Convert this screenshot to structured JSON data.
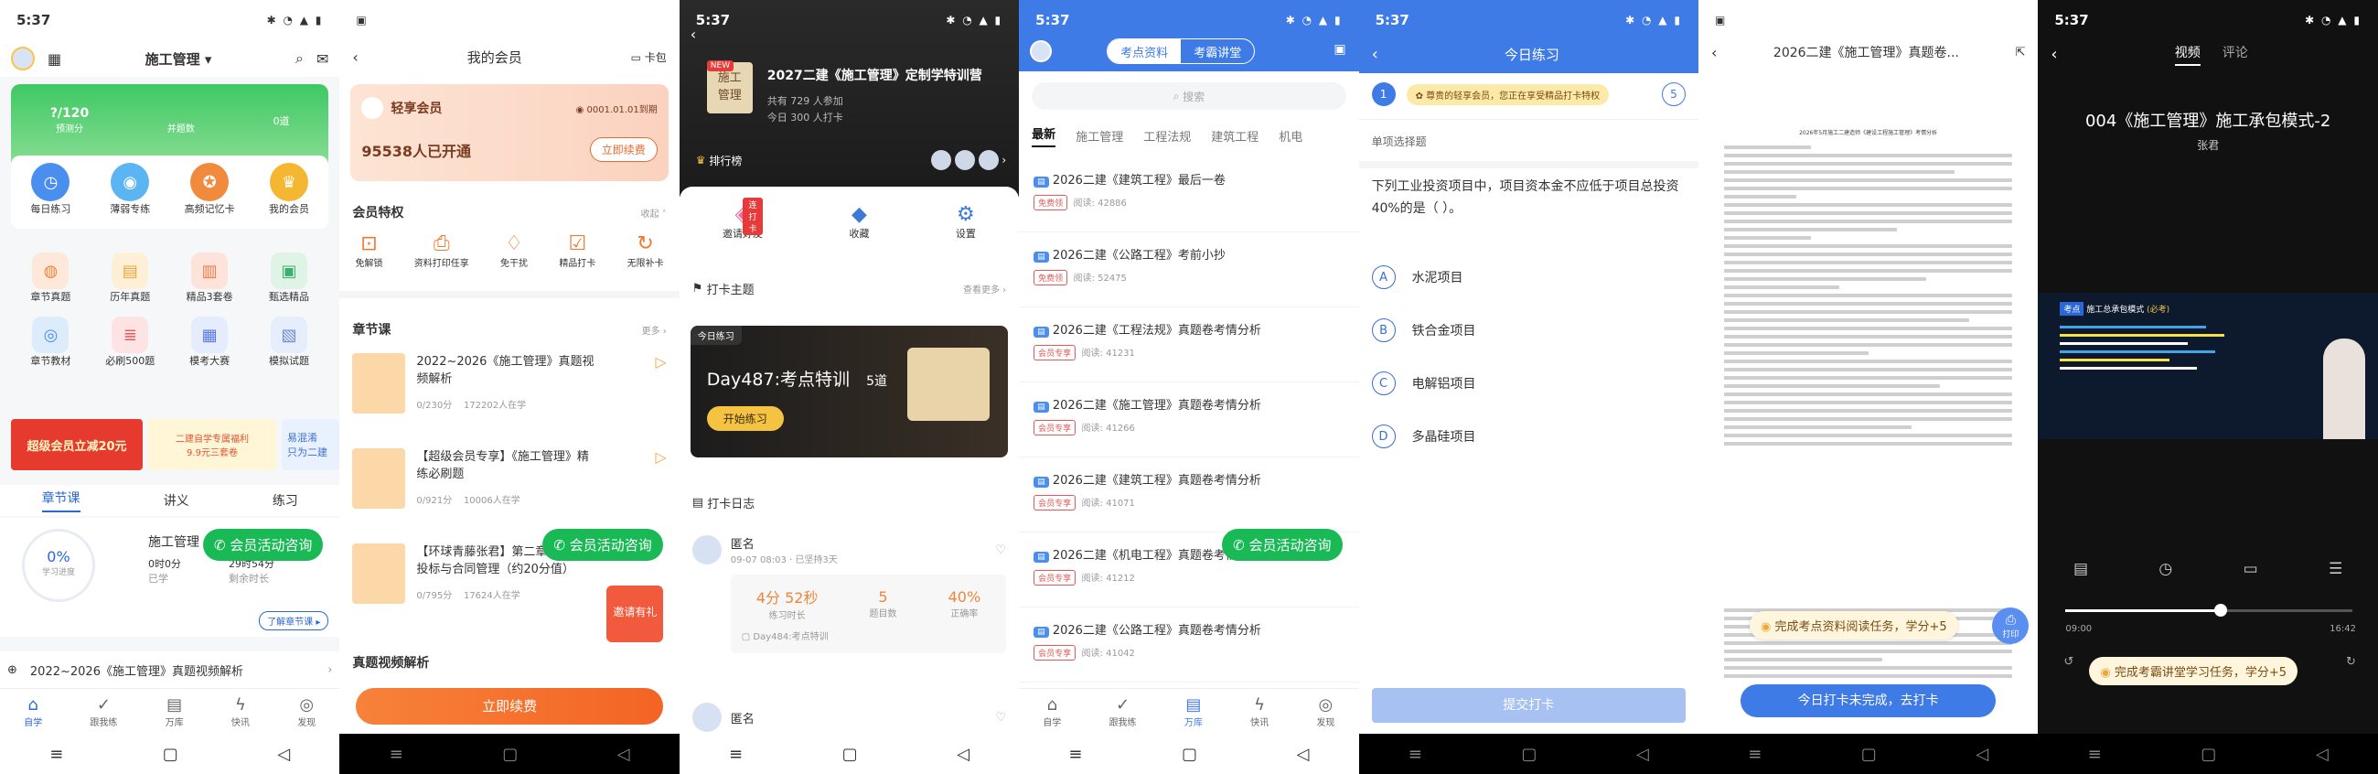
{
  "time": "5:37",
  "s1": {
    "title": "施工管理",
    "stats": [
      {
        "v": "?/120",
        "l": "预测分"
      },
      {
        "v": "",
        "l": "并题数"
      },
      {
        "v": "0道",
        "l": ""
      }
    ],
    "icons1": [
      "每日练习",
      "薄弱专练",
      "高频记忆卡",
      "我的会员"
    ],
    "icons2": [
      "章节真题",
      "历年真题",
      "精品3套卷",
      "甄选精品"
    ],
    "icons3": [
      "章节教材",
      "必刷500题",
      "模考大赛",
      "模拟试题"
    ],
    "banner1": "超级会员立减20元",
    "banner2": "二建自学专属福利\n9.9元三套卷",
    "banner3": "易混淆\n只为二建",
    "tabs": [
      "章节课",
      "讲义",
      "练习"
    ],
    "progress": "0%",
    "progress_label": "学习进度",
    "course": "施工管理",
    "studied": "0时0分",
    "studied_l": "已学",
    "left": "29时54分",
    "left_l": "剩余时长",
    "wechat": "会员活动咨询",
    "more": "了解章节课",
    "bottom_item": "2022~2026《施工管理》真题视频解析",
    "tabbar": [
      "自学",
      "跟我练",
      "万库",
      "快讯",
      "发现"
    ]
  },
  "s2": {
    "title": "我的会员",
    "card_link": "卡包",
    "level": "轻享会员",
    "expire": "0001.01.01到期",
    "joined": "95538人已开通",
    "renew": "立即续费",
    "priv_title": "会员特权",
    "priv_more": "收起",
    "privs": [
      "免解锁",
      "资料打印任享",
      "免干扰",
      "精品打卡",
      "无限补卡"
    ],
    "chapter_title": "章节课",
    "chapter_more": "更多",
    "courses": [
      {
        "t": "2022~2026《施工管理》真题视频解析",
        "p": "0/230分",
        "n": "172202人在学"
      },
      {
        "t": "【超级会员专享】《施工管理》精练必刷题",
        "p": "0/921分",
        "n": "10006人在学"
      },
      {
        "t": "【环球青藤张君】第二章施工招标投标与合同管理（约20分值）",
        "p": "0/795分",
        "n": "17624人在学"
      }
    ],
    "wechat": "会员活动咨询",
    "gift": "邀请有礼",
    "video_title": "真题视频解析",
    "cta": "立即续费"
  },
  "s3": {
    "course": "2027二建《施工管理》定制学特训营",
    "badge": "NEW",
    "cover": "施工\n管理",
    "join": "共有 729 人参加",
    "today": "今日 300 人打卡",
    "rank": "排行榜",
    "actions": [
      "邀请好友",
      "收藏",
      "设置"
    ],
    "invite_badge": "连打卡",
    "theme_title": "打卡主题",
    "theme_more": "查看更多",
    "today_tag": "今日练习",
    "day": "Day487:考点特训",
    "count": "5道",
    "start": "开始练习",
    "log_title": "打卡日志",
    "user": "匿名",
    "date": "09-07 08:03 · 已坚持3天",
    "stats": [
      {
        "v": "4分 52秒",
        "l": "练习时长"
      },
      {
        "v": "5",
        "l": "题目数"
      },
      {
        "v": "40%",
        "l": "正确率"
      }
    ],
    "day_log": "Day484:考点特训",
    "user2": "匿名"
  },
  "s4": {
    "tabs": [
      "考点资料",
      "考霸讲堂"
    ],
    "search": "搜索",
    "cats": [
      "最新",
      "施工管理",
      "工程法规",
      "建筑工程",
      "机电"
    ],
    "items": [
      {
        "t": "2026二建《建筑工程》最后一卷",
        "tag": "免费领",
        "r": "阅读: 42886"
      },
      {
        "t": "2026二建《公路工程》考前小抄",
        "tag": "免费领",
        "r": "阅读: 52475"
      },
      {
        "t": "2026二建《工程法规》真题卷考情分析",
        "tag": "会员专享",
        "r": "阅读: 41231"
      },
      {
        "t": "2026二建《施工管理》真题卷考情分析",
        "tag": "会员专享",
        "r": "阅读: 41266"
      },
      {
        "t": "2026二建《建筑工程》真题卷考情分析",
        "tag": "会员专享",
        "r": "阅读: 41071"
      },
      {
        "t": "2026二建《机电工程》真题卷考情分析",
        "tag": "会员专享",
        "r": "阅读: 41212"
      },
      {
        "t": "2026二建《公路工程》真题卷考情分析",
        "tag": "会员专享",
        "r": "阅读: 41042"
      }
    ],
    "wechat": "会员活动咨询",
    "tabbar": [
      "自学",
      "跟我练",
      "万库",
      "快讯",
      "发现"
    ]
  },
  "s5": {
    "title": "今日练习",
    "toast": "尊贵的轻享会员，您正在享受精品打卡特权",
    "q_no": "1",
    "q_last": "5",
    "type": "单项选择题",
    "question": "下列工业投资项目中，项目资本金不应低于项目总投资40%的是（   ）。",
    "options": [
      {
        "k": "A",
        "t": "水泥项目"
      },
      {
        "k": "B",
        "t": "铁合金项目"
      },
      {
        "k": "C",
        "t": "电解铝项目"
      },
      {
        "k": "D",
        "t": "多晶硅项目"
      }
    ],
    "submit": "提交打卡"
  },
  "s6": {
    "title": "2026二建《施工管理》真题卷...",
    "doc_title": "2026年5月施工二建造师《建设工程施工管理》考情分析",
    "toast": "完成考点资料阅读任务，学分+5",
    "print": "打印",
    "cta": "今日打卡未完成，去打卡"
  },
  "s7": {
    "tabs": [
      "视频",
      "评论"
    ],
    "title": "004《施工管理》施工承包模式-2",
    "teacher": "张君",
    "slide_tag": "考点",
    "slide_title": "施工总承包模式",
    "slide_note": "(必考)",
    "t_start": "09:00",
    "t_end": "16:42",
    "progress": 0.54,
    "toast": "完成考霸讲堂学习任务，学分+5"
  }
}
